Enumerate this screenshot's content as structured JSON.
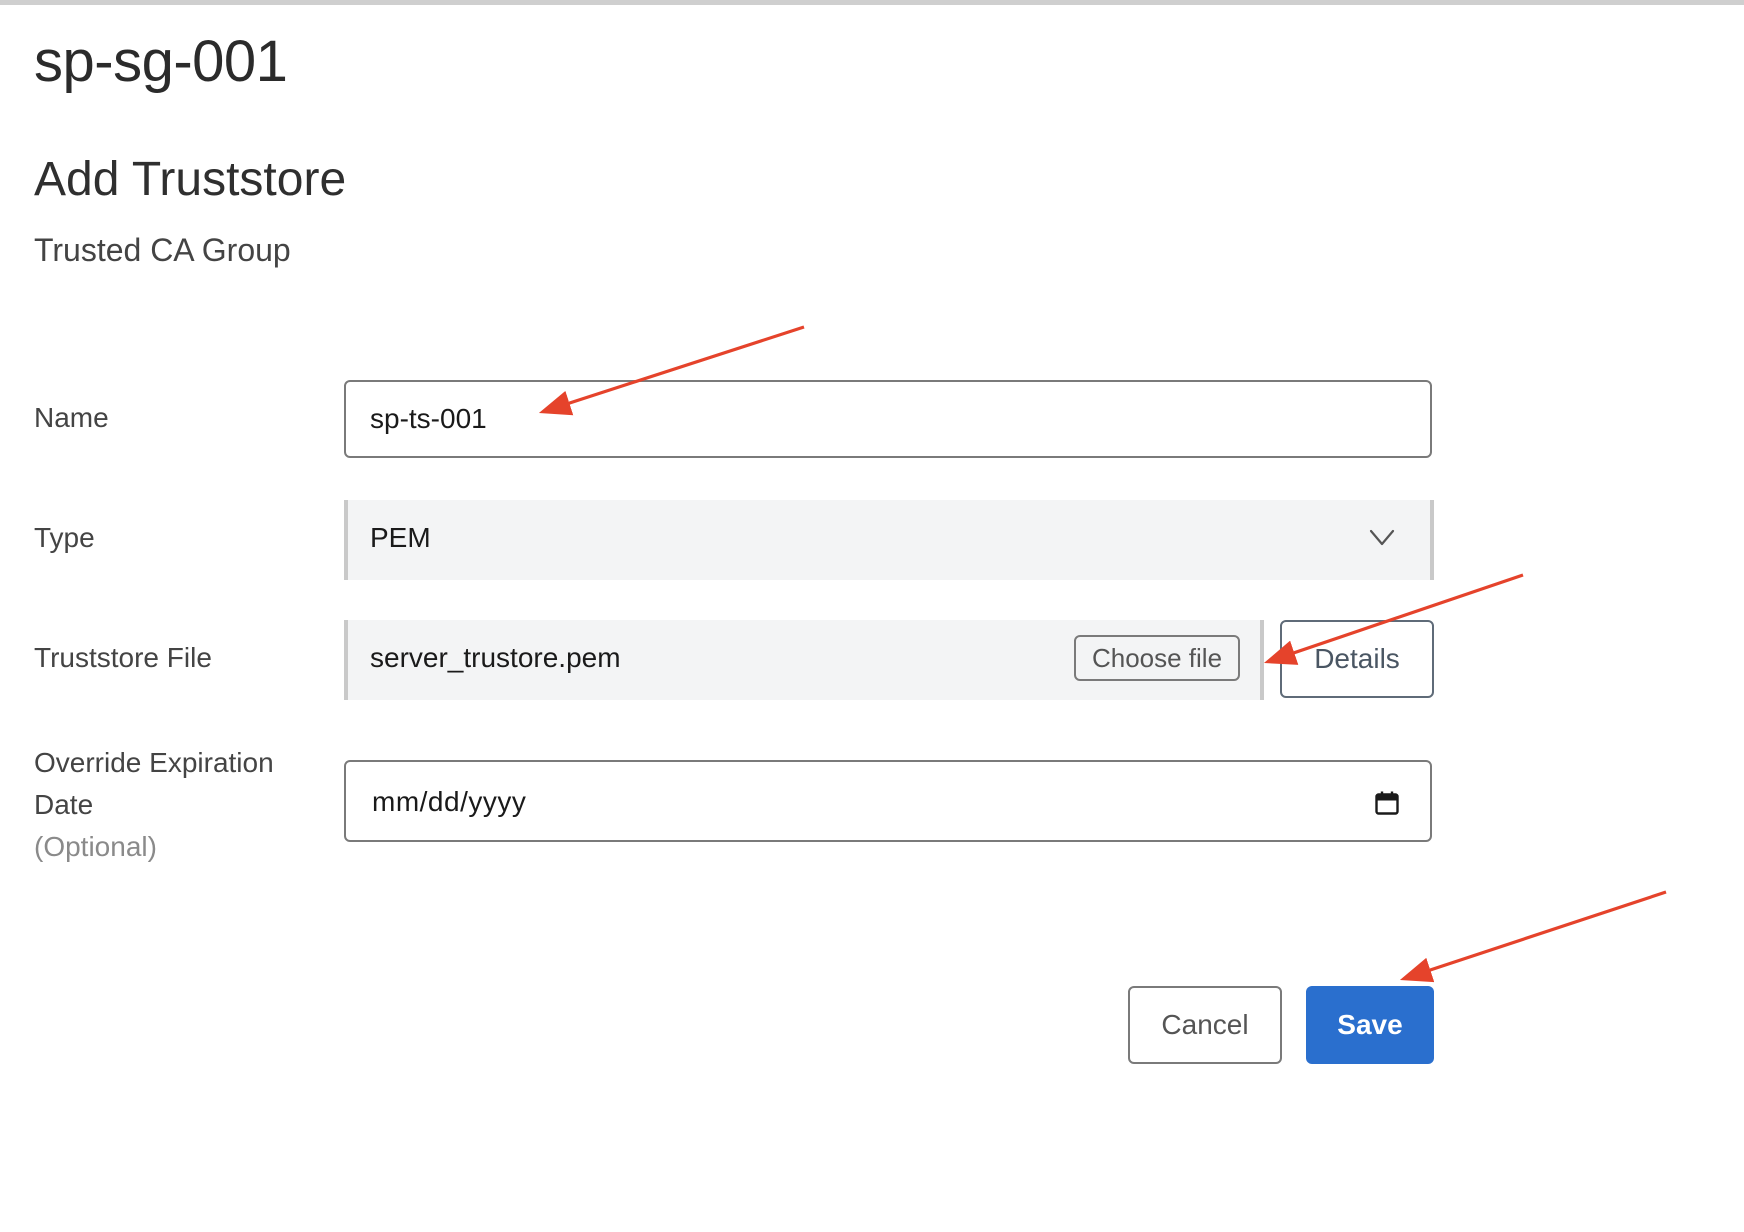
{
  "page": {
    "title": "sp-sg-001"
  },
  "form": {
    "heading": "Add Truststore",
    "subheading": "Trusted CA Group",
    "name": {
      "label": "Name",
      "value": "sp-ts-001"
    },
    "type": {
      "label": "Type",
      "selected": "PEM"
    },
    "truststore_file": {
      "label": "Truststore File",
      "file_name": "server_trustore.pem",
      "choose_label": "Choose file",
      "details_label": "Details"
    },
    "expiration": {
      "label_line1": "Override Expiration",
      "label_line2": "Date",
      "optional": "(Optional)",
      "placeholder": "mm/dd/yyyy"
    }
  },
  "actions": {
    "cancel_label": "Cancel",
    "save_label": "Save"
  },
  "colors": {
    "primary": "#2a6fce",
    "annotation_arrow": "#e5432b",
    "field_bg": "#f3f4f5"
  },
  "icons": {
    "type_dropdown": "chevron-down-icon",
    "date_picker": "calendar-icon"
  }
}
